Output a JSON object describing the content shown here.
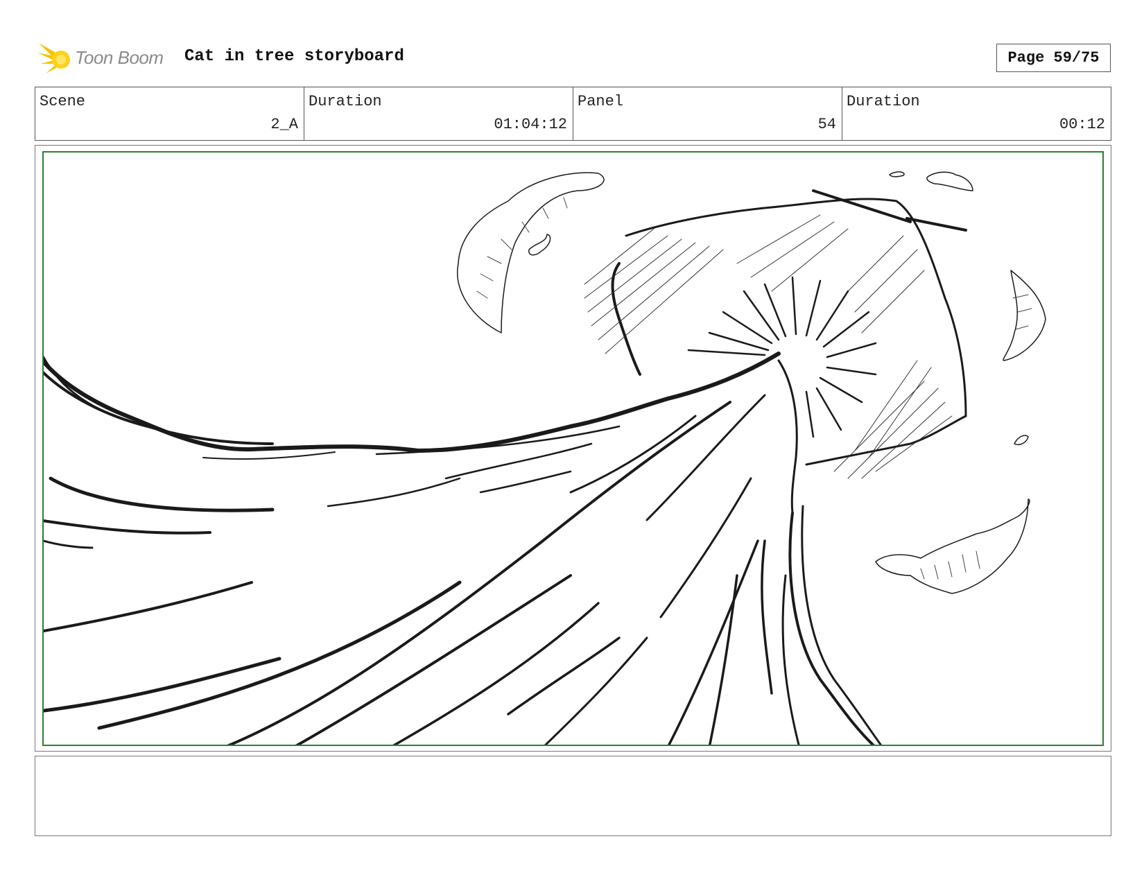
{
  "header": {
    "logo_text": "Toon Boom",
    "title": "Cat in tree storyboard",
    "page_label": "Page 59/75"
  },
  "info": {
    "scene_label": "Scene",
    "scene_value": "2_A",
    "scene_duration_label": "Duration",
    "scene_duration_value": "01:04:12",
    "panel_label": "Panel",
    "panel_value": "54",
    "panel_duration_label": "Duration",
    "panel_duration_value": "00:12"
  },
  "panel": {
    "sketch": "sketch-wave-tree",
    "safe_area_color": "#2e7d32"
  },
  "notes": {
    "text": ""
  }
}
